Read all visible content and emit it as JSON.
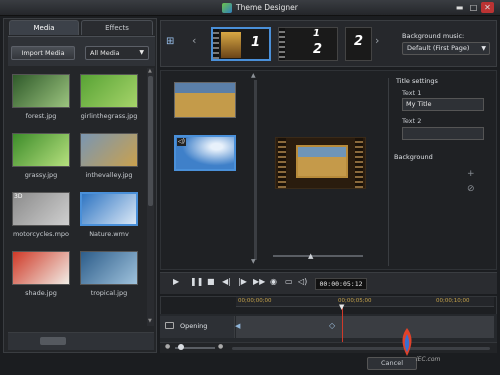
{
  "window": {
    "title": "Theme Designer",
    "minimize": "▬",
    "maximize": "□",
    "close": "✕"
  },
  "tabs": {
    "media": "Media",
    "effects": "Effects"
  },
  "toolbar": {
    "import_label": "Import Media",
    "filter_value": "All Media",
    "caret": "▼"
  },
  "media_items": [
    {
      "label": "forest.jpg",
      "colors": [
        "#2f5a2a",
        "#9cc47f"
      ],
      "badge": "",
      "selected": false
    },
    {
      "label": "girlinthegrass.jpg",
      "colors": [
        "#58a335",
        "#a6d46a"
      ],
      "badge": "",
      "selected": false
    },
    {
      "label": "grassy.jpg",
      "colors": [
        "#3d8c2a",
        "#b6e07e"
      ],
      "badge": "",
      "selected": false
    },
    {
      "label": "inthevalley.jpg",
      "colors": [
        "#7a96b2",
        "#c9a14e"
      ],
      "badge": "",
      "selected": false
    },
    {
      "label": "motorcycles.mpo",
      "colors": [
        "#8b8b8b",
        "#cfcfcf"
      ],
      "badge": "3D",
      "selected": false
    },
    {
      "label": "Nature.wmv",
      "colors": [
        "#2f75c2",
        "#dbe8f6"
      ],
      "badge": "",
      "selected": true
    },
    {
      "label": "shade.jpg",
      "colors": [
        "#cf3a28",
        "#f1ede6"
      ],
      "badge": "",
      "selected": false
    },
    {
      "label": "tropical.jpg",
      "colors": [
        "#2d5d8a",
        "#9fc2dc"
      ],
      "badge": "",
      "selected": false
    }
  ],
  "theme_strip": {
    "add_icon": "add-scene-icon",
    "prev": "‹",
    "next": "›",
    "tiles": [
      "1",
      "2",
      "1",
      "2"
    ]
  },
  "background_music": {
    "label": "Background music:",
    "value": "Default (First Page)",
    "caret": "▼"
  },
  "title_settings": {
    "heading": "Title settings",
    "text1_label": "Text 1",
    "text1_value": "My Title",
    "text2_label": "Text 2",
    "text2_value": ""
  },
  "background": {
    "heading": "Background",
    "add": "+",
    "remove": "⊘"
  },
  "transport": {
    "timecode": "00:00:05:12",
    "play": "▶",
    "pause": "❚❚",
    "stop": "■",
    "prev_frame": "◀|",
    "next_frame": "|▶",
    "fast_forward": "▶▶",
    "snapshot": "◉",
    "display": "▭",
    "volume": "◁)"
  },
  "timeline": {
    "ticks": [
      "00;00;00;00",
      "00;00;05;00",
      "00;00;10;00"
    ],
    "track_label": "Opening",
    "playhead_time": "00;00;05;12"
  },
  "footer": {
    "cancel": "Cancel",
    "watermark": "iEC.com"
  },
  "colors": {
    "accent": "#4a90d9",
    "playhead": "#d03a2a",
    "ruler_text": "#c5a24a"
  }
}
